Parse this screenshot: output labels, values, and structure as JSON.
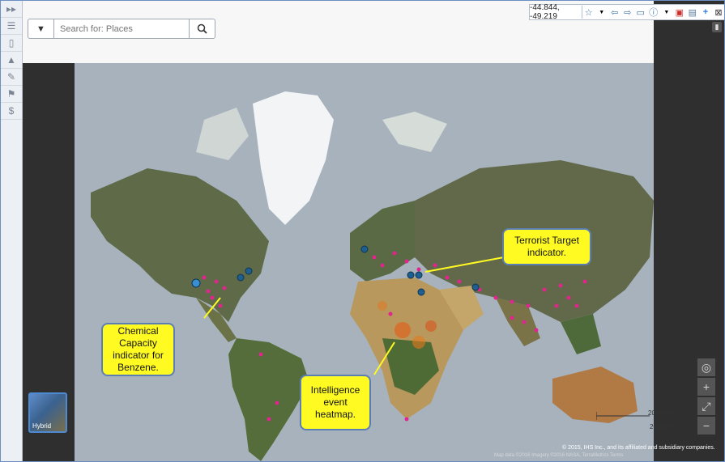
{
  "search": {
    "placeholder": "Search for: Places"
  },
  "toolbar": {
    "coordinates": "-44.844,  -49.219"
  },
  "callouts": {
    "terrorist": "Terrorist Target indicator.",
    "chemical": "Chemical Capacity indicator for Benzene.",
    "intel": "Intelligence event heatmap."
  },
  "minimap": {
    "label": "Hybrid"
  },
  "scale": {
    "km": "2000km",
    "mi": "2000mi"
  },
  "attribution": {
    "line1": "© 2015, IHS Inc., and its affiliated and subsidiary companies.",
    "line2": "Map data ©2016 Imagery ©2016 NASA, TerraMetrics   Terms"
  },
  "colors": {
    "callout_fill": "#fffb22",
    "callout_border": "#5b7fb3",
    "marker_pink": "#e0268c",
    "marker_blue": "#1f5f8f"
  }
}
